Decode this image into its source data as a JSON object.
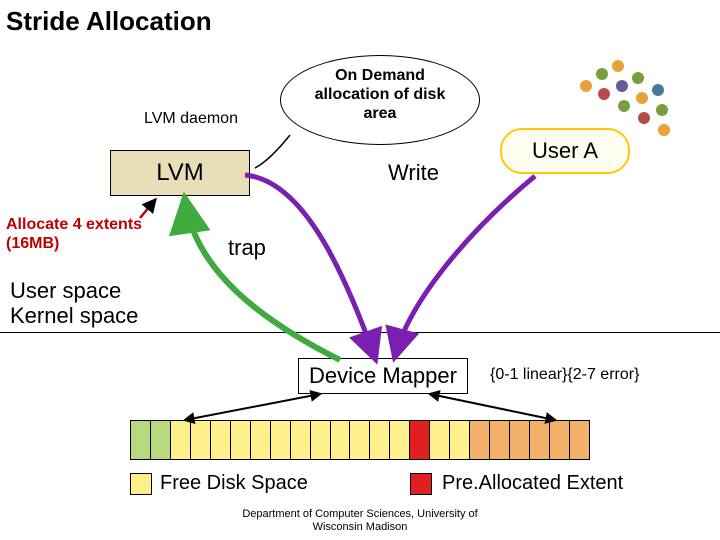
{
  "title": "Stride Allocation",
  "lvm_daemon_label": "LVM daemon",
  "cloud_text": "On Demand allocation of disk area",
  "lvm_box": "LVM",
  "write_label": "Write",
  "user_a": "User A",
  "allocate_label_line1": "Allocate 4 extents",
  "allocate_label_line2": "(16MB)",
  "trap_label": "trap",
  "user_space": "User space",
  "kernel_space": "Kernel space",
  "device_mapper": "Device Mapper",
  "mapping_spec": "{0-1 linear}{2-7 error}",
  "legend_free": "Free Disk Space",
  "legend_prealloc": "Pre.Allocated Extent",
  "footer_line1": "Department of Computer Sciences, University of",
  "footer_line2": "Wisconsin Madison",
  "disk_cells": [
    "green",
    "green",
    "yell",
    "yell",
    "yell",
    "yell",
    "yell",
    "yell",
    "yell",
    "yell",
    "yell",
    "yell",
    "yell",
    "yell",
    "red",
    "yell",
    "yell",
    "orange",
    "orange",
    "orange",
    "orange",
    "orange",
    "orange"
  ],
  "colors": {
    "red": "#e02020",
    "green": "#b7d97f",
    "yellow": "#fef08a",
    "orange": "#f3b26b",
    "dot_colors": [
      "#e9a23b",
      "#799e3f",
      "#b84a4a",
      "#6a5a9a",
      "#4a7a9a"
    ]
  }
}
